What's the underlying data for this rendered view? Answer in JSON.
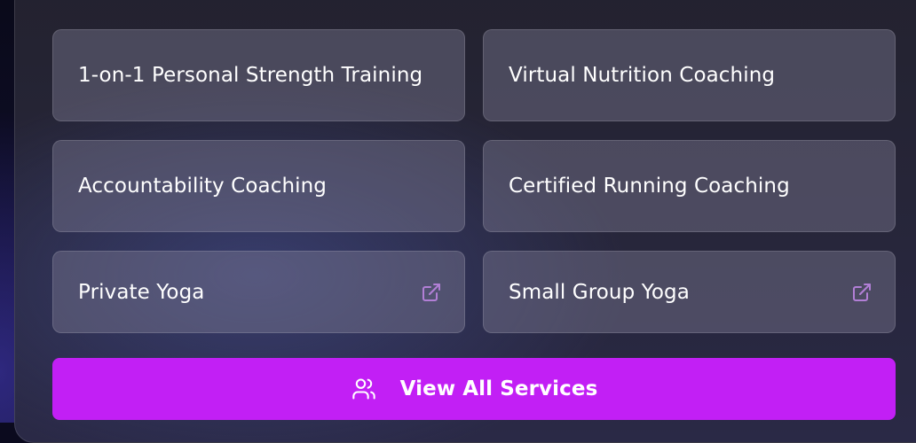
{
  "services": [
    {
      "label": "1-on-1 Personal Strength Training",
      "external": false
    },
    {
      "label": "Virtual Nutrition Coaching",
      "external": false
    },
    {
      "label": "Accountability Coaching",
      "external": false
    },
    {
      "label": "Certified Running Coaching",
      "external": false
    },
    {
      "label": "Private Yoga",
      "external": true,
      "icon": "external-link-icon"
    },
    {
      "label": "Small Group Yoga",
      "external": true,
      "icon": "external-link-icon"
    }
  ],
  "cta": {
    "label": "View All Services",
    "icon": "users-icon"
  },
  "colors": {
    "accent": "#c21ff5",
    "external_icon": "#b27fd6",
    "card_text": "#ffffff"
  }
}
